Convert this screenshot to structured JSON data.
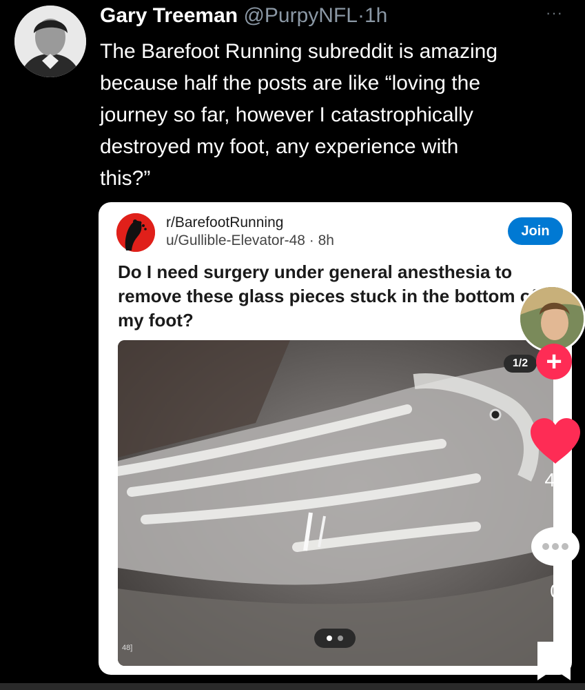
{
  "tweet": {
    "author_name": "Gary Treeman",
    "author_handle": "@PurpyNFL",
    "separator": "·",
    "time": "1h",
    "more_label": "···",
    "text": "The Barefoot Running subreddit is amazing\nbecause half the posts are like “loving the\njourney so far, however I catastrophically\ndestroyed my foot, any experience with\nthis?”"
  },
  "reddit_post": {
    "subreddit": "r/BarefootRunning",
    "username": "u/Gullible-Elevator-48",
    "separator": "·",
    "time": "8h",
    "join_label": "Join",
    "title": "Do I need surgery under general anesthesia to remove these glass pieces stuck in the bottom of my foot?",
    "image_marker": "48]",
    "carousel": {
      "count": 2,
      "active": 0
    }
  },
  "overlay": {
    "page_indicator": "1/2",
    "follow_label": "+",
    "like_count": "48",
    "comment_count": "0"
  },
  "colors": {
    "like": "#fe2c55",
    "follow": "#fe2c55",
    "join": "#0079d3",
    "subreddit_icon": "#e0201a"
  }
}
